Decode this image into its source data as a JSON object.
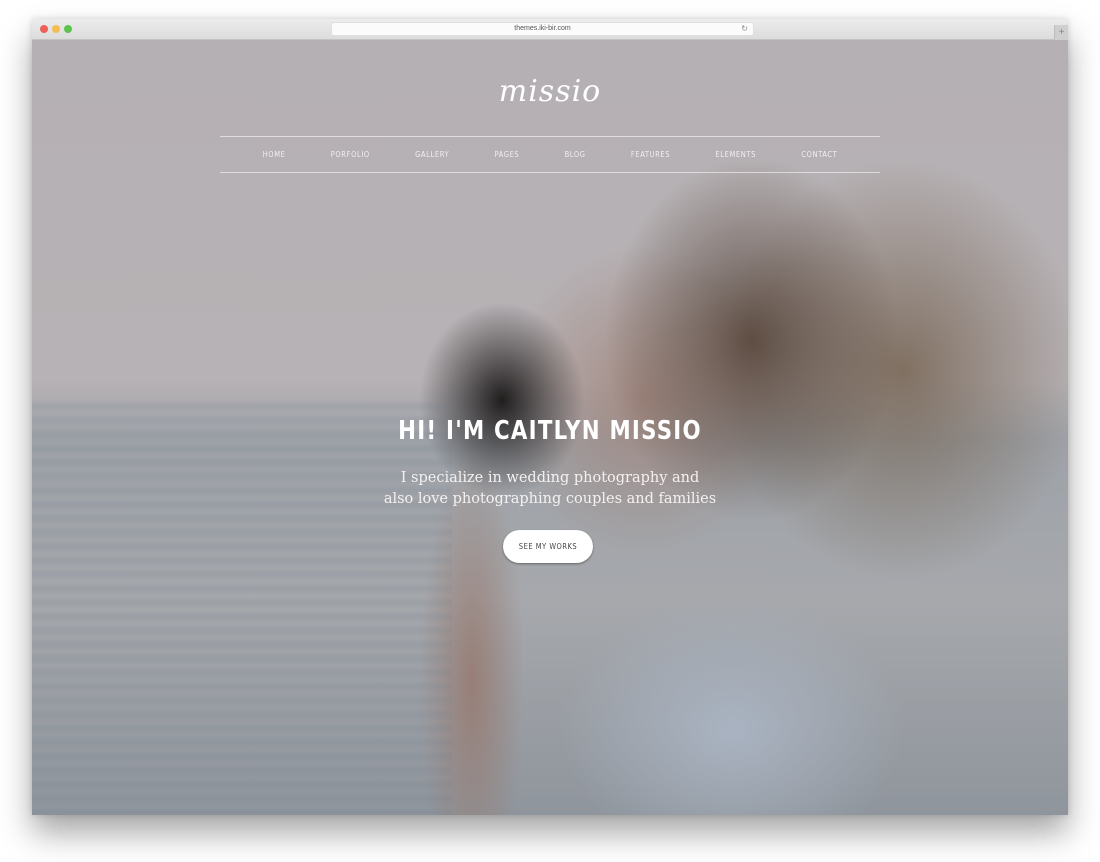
{
  "browser": {
    "url": "themes.iki-bir.com",
    "reload_icon": "reload-icon",
    "new_tab_icon": "plus-icon",
    "traffic_lights": [
      "close",
      "minimize",
      "maximize"
    ]
  },
  "site": {
    "logo": "missio",
    "nav": [
      "HOME",
      "PORFOLIO",
      "GALLERY",
      "PAGES",
      "BLOG",
      "FEATURES",
      "ELEMENTS",
      "CONTACT"
    ],
    "hero": {
      "headline": "HI! I'M CAITLYN MISSIO",
      "subtitle_line1": "I specialize in wedding photography and",
      "subtitle_line2": "also love photographing couples and families",
      "cta_label": "SEE MY WORKS"
    }
  },
  "colors": {
    "close": "#ee5f58",
    "minimize": "#f4bd4f",
    "maximize": "#5cc44d",
    "hero_overlay": "#b3aeb1"
  }
}
